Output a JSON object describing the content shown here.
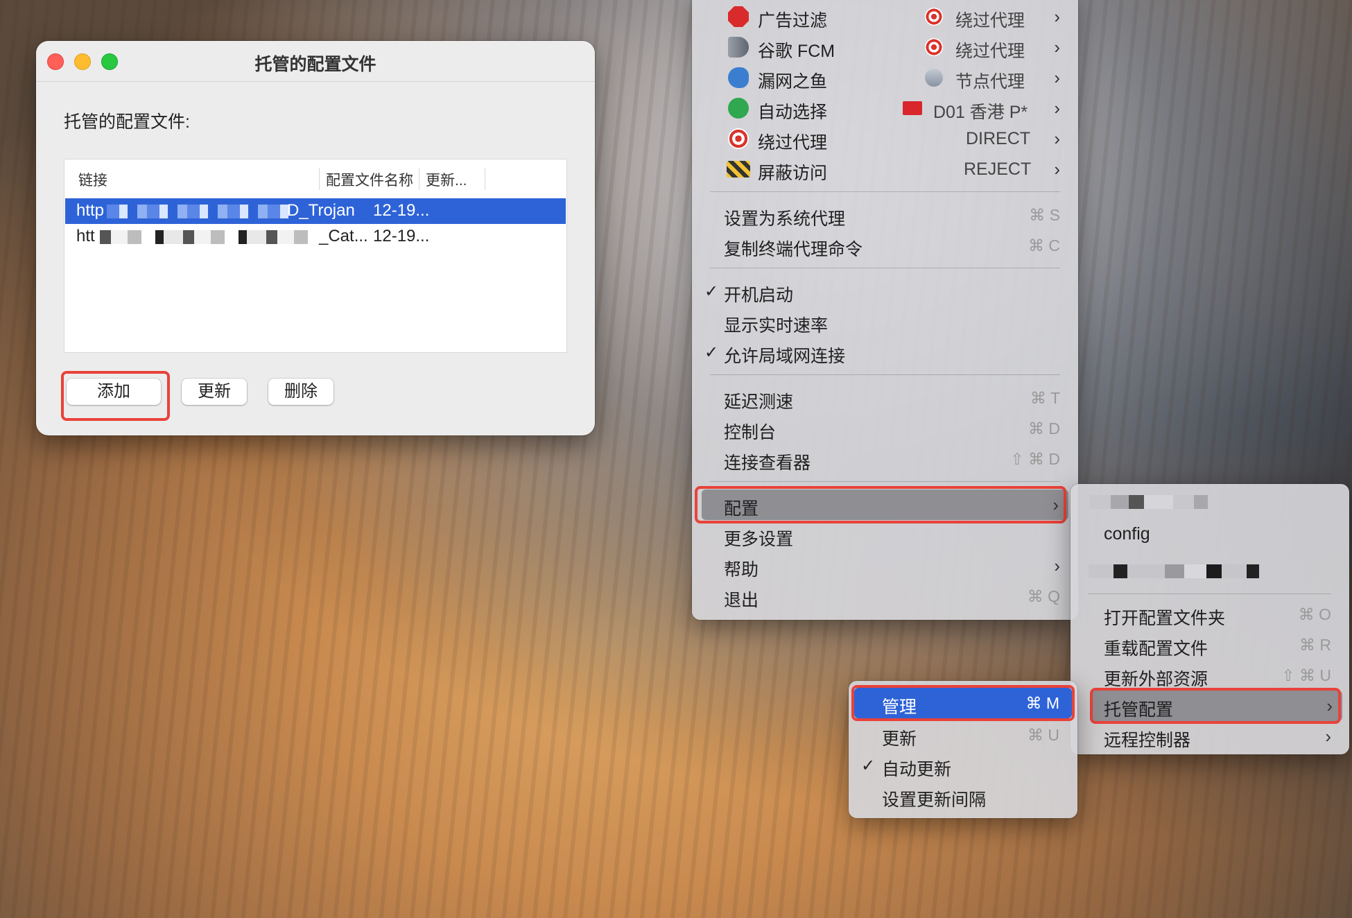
{
  "window": {
    "title": "托管的配置文件",
    "section_label": "托管的配置文件:",
    "table": {
      "columns": [
        "链接",
        "配置文件名称",
        "更新..."
      ],
      "rows": [
        {
          "link": "http",
          "name": "D_Trojan",
          "updated": "12-19...",
          "selected": true
        },
        {
          "link": "htt",
          "name": "_Cat...",
          "updated": "12-19...",
          "selected": false
        }
      ]
    },
    "buttons": {
      "add": "添加",
      "update": "更新",
      "delete": "删除"
    }
  },
  "main_menu": {
    "proxy_groups": [
      {
        "icon": "stop-sign-icon",
        "label": "广告过滤",
        "value_icon": "target-icon",
        "value": "绕过代理"
      },
      {
        "icon": "megaphone-icon",
        "label": "谷歌 FCM",
        "value_icon": "target-icon",
        "value": "绕过代理"
      },
      {
        "icon": "fish-icon",
        "label": "漏网之鱼",
        "value_icon": "rocket-icon",
        "value": "节点代理"
      },
      {
        "icon": "recycle-icon",
        "label": "自动选择",
        "value_icon": "hk-flag-icon",
        "value": "D01 香港 P*"
      },
      {
        "icon": "target-icon",
        "label": "绕过代理",
        "value_icon": "",
        "value": "DIRECT"
      },
      {
        "icon": "barrier-icon",
        "label": "屏蔽访问",
        "value_icon": "",
        "value": "REJECT"
      }
    ],
    "system": [
      {
        "label": "设置为系统代理",
        "shortcut": "⌘ S"
      },
      {
        "label": "复制终端代理命令",
        "shortcut": "⌘ C"
      }
    ],
    "toggles": [
      {
        "label": "开机启动",
        "checked": true
      },
      {
        "label": "显示实时速率",
        "checked": false
      },
      {
        "label": "允许局域网连接",
        "checked": true
      }
    ],
    "tools": [
      {
        "label": "延迟测速",
        "shortcut": "⌘ T"
      },
      {
        "label": "控制台",
        "shortcut": "⌘ D"
      },
      {
        "label": "连接查看器",
        "shortcut": "⇧ ⌘ D"
      }
    ],
    "bottom": [
      {
        "label": "配置",
        "submenu": true,
        "highlighted": true
      },
      {
        "label": "更多设置",
        "submenu": false
      },
      {
        "label": "帮助",
        "submenu": true
      },
      {
        "label": "退出",
        "shortcut": "⌘ Q"
      }
    ]
  },
  "config_menu": {
    "configs": [
      "config"
    ],
    "items": [
      {
        "label": "打开配置文件夹",
        "shortcut": "⌘ O"
      },
      {
        "label": "重载配置文件",
        "shortcut": "⌘ R"
      },
      {
        "label": "更新外部资源",
        "shortcut": "⇧ ⌘ U"
      },
      {
        "label": "托管配置",
        "submenu": true,
        "highlighted": true
      },
      {
        "label": "远程控制器",
        "submenu": true
      }
    ]
  },
  "managed_menu": {
    "items": [
      {
        "label": "管理",
        "shortcut": "⌘ M",
        "highlighted": true
      },
      {
        "label": "更新",
        "shortcut": "⌘ U"
      },
      {
        "label": "自动更新",
        "checked": true
      },
      {
        "label": "设置更新间隔"
      }
    ]
  },
  "colors": {
    "accent_blue": "#2e63d8",
    "annotation_red": "#e8423a"
  }
}
